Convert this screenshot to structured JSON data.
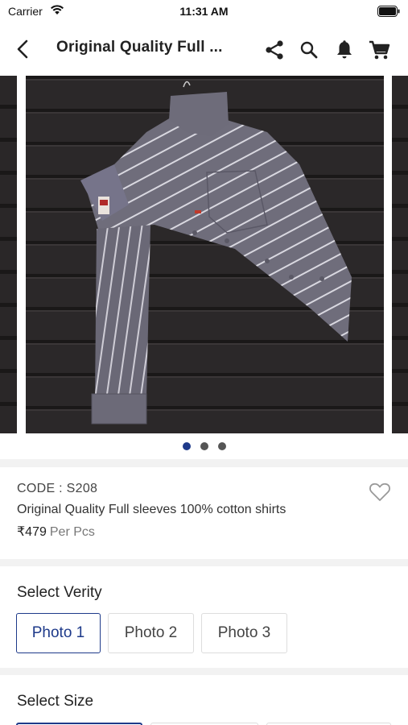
{
  "status_bar": {
    "carrier": "Carrier",
    "time": "11:31 AM"
  },
  "nav": {
    "title": "Original Quality Full ...",
    "icons": [
      "back-icon",
      "share-icon",
      "search-icon",
      "bell-icon",
      "cart-icon"
    ]
  },
  "carousel": {
    "slide_count": 3,
    "active_index": 0
  },
  "product": {
    "code": "CODE : S208",
    "description": "Original Quality Full sleeves 100% cotton shirts",
    "price": "₹479",
    "unit": "Per Pcs",
    "favorite_icon": "heart-outline-icon"
  },
  "variety": {
    "title": "Select Verity",
    "options": [
      "Photo 1",
      "Photo 2",
      "Photo 3"
    ],
    "selected": 0
  },
  "size": {
    "title": "Select Size"
  },
  "colors": {
    "accent": "#1e3a8a",
    "background": "#f2f2f2"
  }
}
